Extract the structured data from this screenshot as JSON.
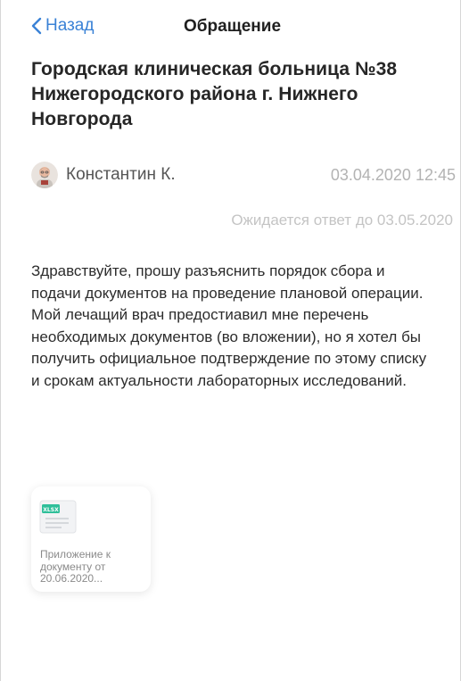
{
  "header": {
    "back_label": "Назад",
    "title": "Обращение"
  },
  "request": {
    "organization": "Городская клиническая больница №38 Нижегородского района г. Нижнего Новгорода",
    "author": "Константин К.",
    "date": "03.04.2020 12:45",
    "deadline": "Ожидается ответ до 03.05.2020",
    "message": "Здравствуйте, прошу разъяснить порядок сбора и подачи документов на проведение плановой операции. Мой лечащий врач предостиавил мне перечень необходимых документов (во вложении), но я хотел бы получить официальное подтверждение по этому списку и срокам актуальности лабораторных исследований."
  },
  "attachment": {
    "badge": "XLSX",
    "label": "Приложение к документу от 20.06.2020..."
  },
  "colors": {
    "accent": "#3a82d6",
    "badge": "#2fbf9a",
    "muted": "#b3b3b3"
  },
  "icons": {
    "back": "chevron-left-icon",
    "avatar": "user-avatar",
    "file": "xlsx-file-icon"
  }
}
